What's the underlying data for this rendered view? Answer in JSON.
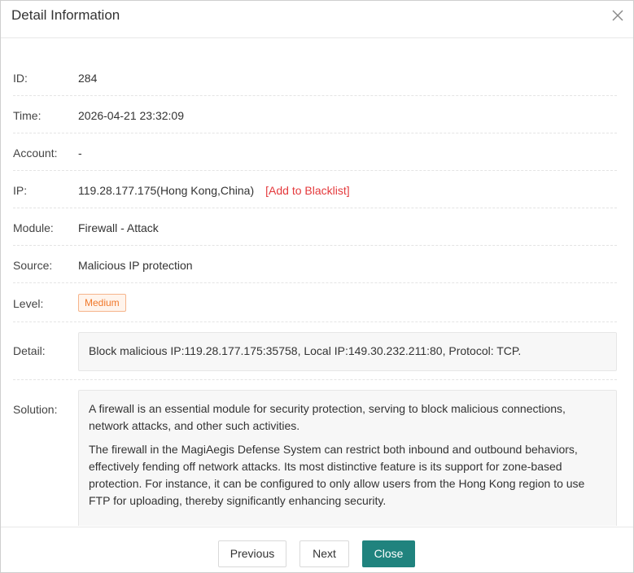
{
  "dialog": {
    "title": "Detail Information",
    "close_icon": "close-icon"
  },
  "fields": {
    "id": {
      "label": "ID:",
      "value": "284"
    },
    "time": {
      "label": "Time:",
      "value": "2026-04-21 23:32:09"
    },
    "account": {
      "label": "Account:",
      "value": "-"
    },
    "ip": {
      "label": "IP:",
      "value": "119.28.177.175(Hong Kong,China)",
      "action": "[Add to Blacklist]",
      "action_color": "#e4393c"
    },
    "module": {
      "label": "Module:",
      "value": "Firewall - Attack"
    },
    "source": {
      "label": "Source:",
      "value": "Malicious IP protection"
    },
    "level": {
      "label": "Level:",
      "value": "Medium",
      "badge_color": "#f0782a"
    },
    "detail": {
      "label": "Detail:",
      "value": "Block malicious IP:119.28.177.175:35758, Local IP:149.30.232.211:80, Protocol: TCP."
    },
    "solution": {
      "label": "Solution:",
      "paragraphs": [
        "A firewall is an essential module for security protection, serving to block malicious connections, network attacks, and other such activities.",
        "The firewall in the MagiAegis Defense System can restrict both inbound and outbound behaviors, effectively fending off network attacks. Its most distinctive feature is its support for zone-based protection. For instance, it can be configured to only allow users from the Hong Kong region to use FTP for uploading, thereby significantly enhancing security."
      ]
    }
  },
  "footer": {
    "previous_label": "Previous",
    "next_label": "Next",
    "close_label": "Close",
    "primary_color": "#20837e"
  }
}
